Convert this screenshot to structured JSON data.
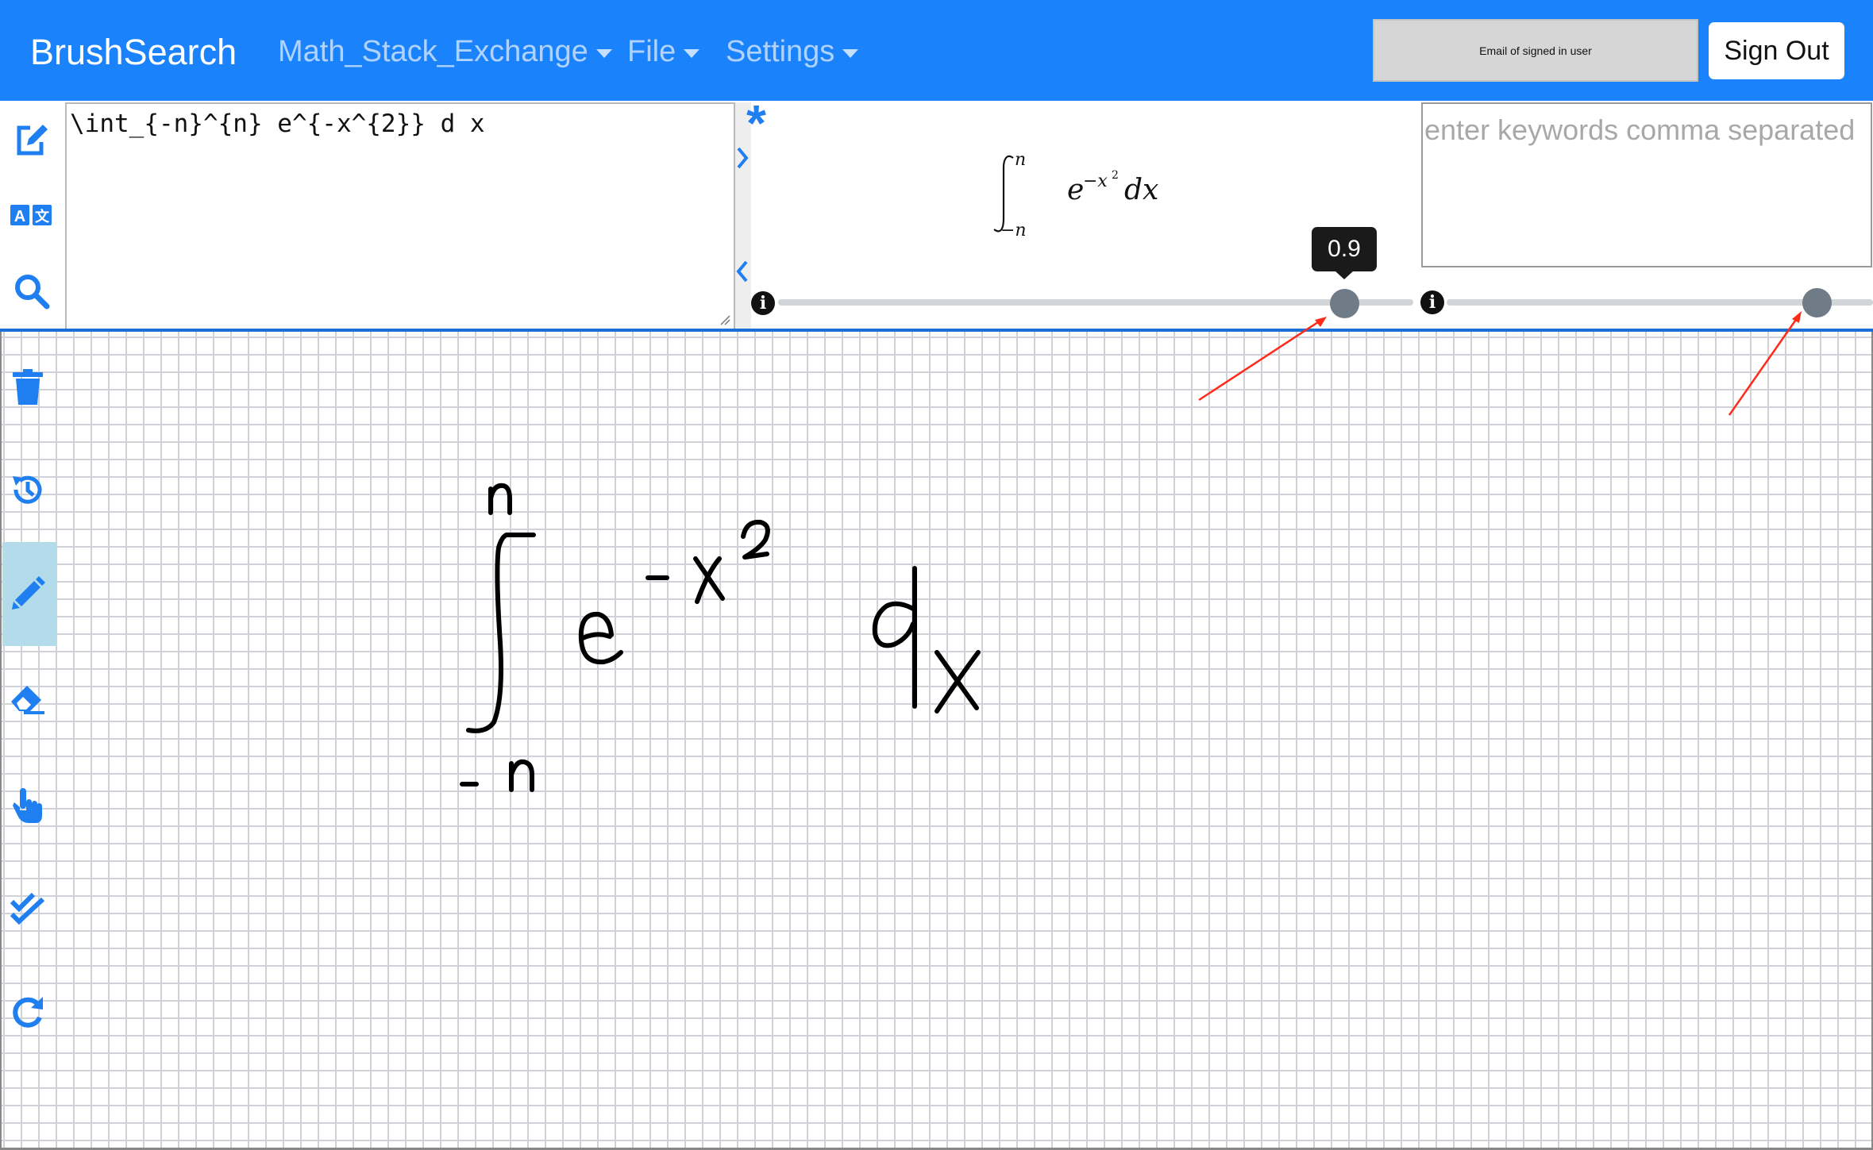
{
  "navbar": {
    "brand": "BrushSearch",
    "menus": [
      {
        "label": "Math_Stack_Exchange"
      },
      {
        "label": "File"
      },
      {
        "label": "Settings"
      }
    ],
    "email_placeholder": "Email of signed in user",
    "sign_out_label": "Sign Out"
  },
  "editor": {
    "latex": "\\int_{-n}^{n} e^{-x^{2}} d x"
  },
  "preview": {
    "marker": "*"
  },
  "sliders": {
    "left": {
      "value": 0.9,
      "tooltip": "0.9"
    },
    "right": {
      "value": 1.0
    }
  },
  "keywords": {
    "placeholder": "enter keywords comma separated",
    "value": ""
  },
  "toolbar_top": [
    {
      "icon": "edit-icon"
    },
    {
      "icon": "translate-icon"
    },
    {
      "icon": "search-icon"
    }
  ],
  "toolbar_side": [
    {
      "icon": "trash-icon"
    },
    {
      "icon": "history-icon"
    },
    {
      "icon": "pencil-icon",
      "active": true
    },
    {
      "icon": "eraser-icon"
    },
    {
      "icon": "hand-pointer-icon"
    },
    {
      "icon": "double-check-icon"
    },
    {
      "icon": "redo-icon"
    }
  ],
  "colors": {
    "navbar": "#1a82fb",
    "icon_blue": "#1f7ef0",
    "active_tool": "#b4dbea",
    "annotation": "#ff2a1a"
  }
}
